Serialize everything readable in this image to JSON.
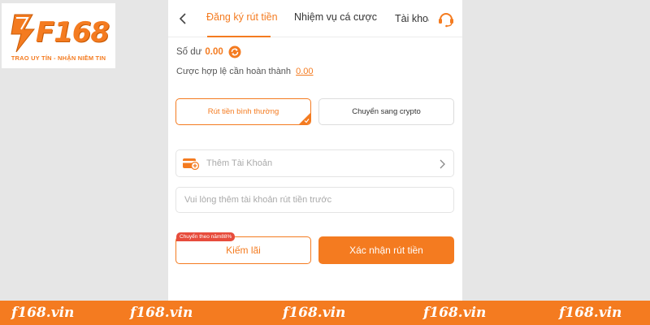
{
  "brand": {
    "logo_text": "F168",
    "slogan": "TRAO UY TÍN - NHẬN NIỀM TIN",
    "accent_color": "#f47b20",
    "badge_color": "#e74c3c"
  },
  "header": {
    "back_icon": "chevron-left-icon",
    "tabs": [
      {
        "label": "Đăng ký rút tiền",
        "active": true
      },
      {
        "label": "Nhiệm vụ cá cược",
        "active": false
      },
      {
        "label": "Tài khoả",
        "active": false
      }
    ],
    "support_icon": "headset-icon"
  },
  "balance": {
    "label": "Số dư",
    "value": "0.00",
    "refresh_icon": "refresh-icon"
  },
  "bet_requirement": {
    "label": "Cược hợp lệ cần hoàn thành",
    "value": "0.00"
  },
  "withdraw_options": [
    {
      "label": "Rút tiền bình thường",
      "selected": true
    },
    {
      "label": "Chuyển sang crypto",
      "selected": false
    }
  ],
  "account": {
    "label": "Thêm Tài Khoản",
    "icon": "card-add-icon",
    "chevron_icon": "chevron-right-icon"
  },
  "hint_input": {
    "placeholder": "Vui lòng thêm tài khoản rút tiền trước",
    "value": ""
  },
  "actions": {
    "promo_badge": "Chuyển theo năm88%",
    "earn_label": "Kiếm lãi",
    "confirm_label": "Xác nhận rút tiền"
  },
  "footer": {
    "links": [
      "f168.vin",
      "f168.vin",
      "f168.vin",
      "f168.vin",
      "f168.vin"
    ]
  }
}
